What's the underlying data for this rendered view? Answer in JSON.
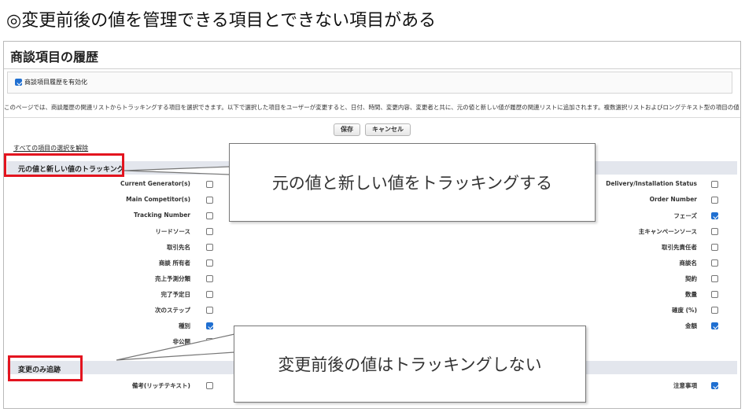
{
  "slide_title": "◎変更前後の値を管理できる項目とできない項目がある",
  "panel": {
    "title": "商談項目の履歴",
    "enable_label": "商談項目履歴を有効化",
    "enable_checked": true,
    "description": "このページでは、商談履歴の関連リストからトラッキングする項目を選択できます。以下で選択した項目をユーザーが変更すると、日付、時間、変更内容、変更者と共に、元の値と新しい値が履歴の関連リストに追加されます。複数選択リストおよびロングテキスト型の項目の値",
    "buttons": {
      "save": "保存",
      "cancel": "キャンセル"
    },
    "deselect_all": "すべての項目の選択を解除"
  },
  "section1": {
    "title": "元の値と新しい値のトラッキング",
    "left_fields": [
      {
        "label": "Current Generator(s)",
        "checked": false
      },
      {
        "label": "Main Competitor(s)",
        "checked": false
      },
      {
        "label": "Tracking Number",
        "checked": false
      },
      {
        "label": "リードソース",
        "checked": false
      },
      {
        "label": "取引先名",
        "checked": false
      },
      {
        "label": "商談 所有者",
        "checked": false
      },
      {
        "label": "売上予測分類",
        "checked": false
      },
      {
        "label": "完了予定日",
        "checked": false
      },
      {
        "label": "次のステップ",
        "checked": false
      },
      {
        "label": "種別",
        "checked": true
      },
      {
        "label": "非公開",
        "checked": false
      }
    ],
    "right_fields": [
      {
        "label": "Delivery/Installation Status",
        "checked": false
      },
      {
        "label": "Order Number",
        "checked": false
      },
      {
        "label": "フェーズ",
        "checked": true
      },
      {
        "label": "主キャンペーンソース",
        "checked": false
      },
      {
        "label": "取引先責任者",
        "checked": false
      },
      {
        "label": "商談名",
        "checked": false
      },
      {
        "label": "契約",
        "checked": false
      },
      {
        "label": "数量",
        "checked": false
      },
      {
        "label": "確度 (%)",
        "checked": false
      },
      {
        "label": "金額",
        "checked": true
      }
    ]
  },
  "section2": {
    "title": "変更のみ追跡",
    "left_fields": [
      {
        "label": "備考(リッチテキスト)",
        "checked": false
      }
    ],
    "right_fields": [
      {
        "label": "注意事項",
        "checked": true
      }
    ]
  },
  "callouts": {
    "top": "元の値と新しい値をトラッキングする",
    "bottom": "変更前後の値はトラッキングしない"
  },
  "colors": {
    "highlight": "#e3141f",
    "checkbox_on": "#1f6fd1",
    "section_bg": "#e3e6ed"
  }
}
